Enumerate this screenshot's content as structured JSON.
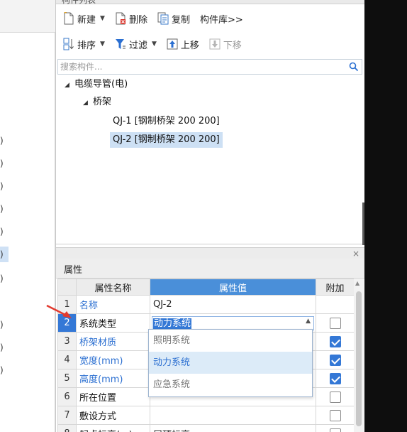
{
  "panel": {
    "header_title": "构件列表"
  },
  "toolbar1": {
    "new_label": "新建",
    "delete_label": "删除",
    "copy_label": "复制",
    "library_label": "构件库>>"
  },
  "toolbar2": {
    "sort_label": "排序",
    "filter_label": "过滤",
    "move_up_label": "上移",
    "move_down_label": "下移"
  },
  "search": {
    "placeholder": "搜索构件..."
  },
  "tree": {
    "root": "电缆导管(电)",
    "group": "桥架",
    "items": [
      "QJ-1 [钢制桥架 200 200]",
      "QJ-2 [钢制桥架 200 200]"
    ],
    "selected": "QJ-2 [钢制桥架 200 200]"
  },
  "left_panel": {
    "visible_chars": [
      ")",
      ")",
      ")",
      ")",
      ")",
      ")",
      ")",
      ")",
      ")",
      ")"
    ]
  },
  "properties": {
    "title": "属性",
    "close_label": "×",
    "headers": {
      "index": "",
      "name": "属性名称",
      "value": "属性值",
      "extra": "附加"
    },
    "rows": [
      {
        "index": "1",
        "name": "名称",
        "value": "QJ-2",
        "name_style": "blue",
        "checkbox": false,
        "has_checkbox": false
      },
      {
        "index": "2",
        "name": "系统类型",
        "value": "动力系统",
        "name_style": "black",
        "checkbox": false,
        "has_checkbox": true
      },
      {
        "index": "3",
        "name": "桥架材质",
        "value": "",
        "name_style": "blue",
        "checkbox": true,
        "has_checkbox": true
      },
      {
        "index": "4",
        "name": "宽度(mm)",
        "value": "",
        "name_style": "blue",
        "checkbox": true,
        "has_checkbox": true
      },
      {
        "index": "5",
        "name": "高度(mm)",
        "value": "",
        "name_style": "blue",
        "checkbox": true,
        "has_checkbox": true
      },
      {
        "index": "6",
        "name": "所在位置",
        "value": "",
        "name_style": "black",
        "checkbox": false,
        "has_checkbox": true
      },
      {
        "index": "7",
        "name": "敷设方式",
        "value": "",
        "name_style": "black",
        "checkbox": false,
        "has_checkbox": true
      },
      {
        "index": "8",
        "name": "起点标高(m)",
        "value": "层顶标高",
        "name_style": "black",
        "checkbox": false,
        "has_checkbox": true
      }
    ],
    "dropdown_options": [
      "照明系统",
      "动力系统",
      "应急系统"
    ],
    "dropdown_hover": "动力系统"
  },
  "colors": {
    "accent": "#3478d6",
    "value_header": "#4a8fd9",
    "selection": "#cde0f4",
    "annotation_arrow": "#e23a2e"
  }
}
